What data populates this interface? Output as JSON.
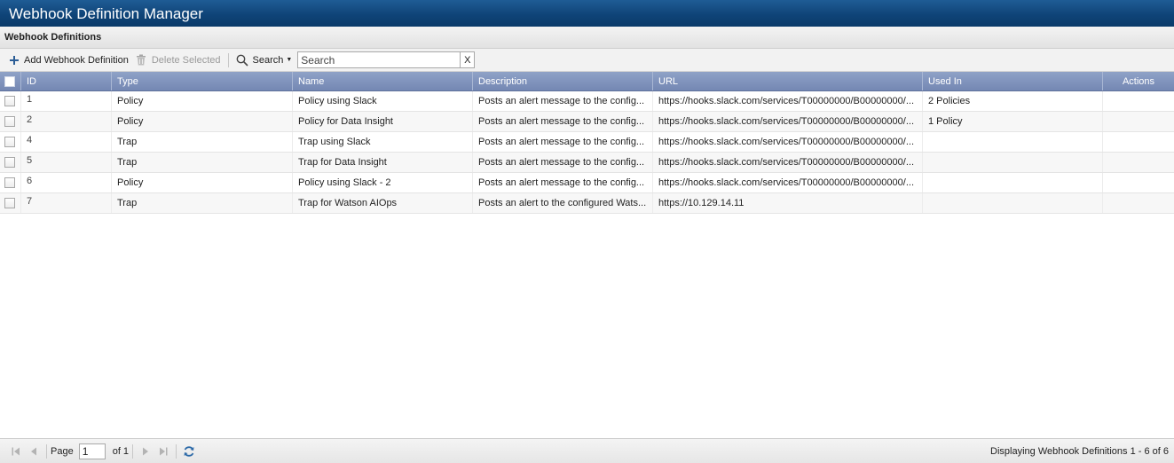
{
  "window": {
    "title": "Webhook Definition Manager"
  },
  "panel": {
    "title": "Webhook Definitions"
  },
  "toolbar": {
    "add_label": "Add Webhook Definition",
    "delete_label": "Delete Selected",
    "search_label": "Search",
    "search_placeholder": "Search",
    "clear_label": "X"
  },
  "grid": {
    "columns": {
      "id": "ID",
      "type": "Type",
      "name": "Name",
      "description": "Description",
      "url": "URL",
      "used_in": "Used In",
      "actions": "Actions"
    },
    "rows": [
      {
        "id": "1",
        "type": "Policy",
        "name": "Policy using Slack",
        "description": "Posts an alert message to the config...",
        "url": "https://hooks.slack.com/services/T00000000/B00000000/...",
        "used_in": "2 Policies"
      },
      {
        "id": "2",
        "type": "Policy",
        "name": "Policy for Data Insight",
        "description": "Posts an alert message to the config...",
        "url": "https://hooks.slack.com/services/T00000000/B00000000/...",
        "used_in": "1 Policy"
      },
      {
        "id": "4",
        "type": "Trap",
        "name": "Trap using Slack",
        "description": "Posts an alert message to the config...",
        "url": "https://hooks.slack.com/services/T00000000/B00000000/...",
        "used_in": ""
      },
      {
        "id": "5",
        "type": "Trap",
        "name": "Trap for Data Insight",
        "description": "Posts an alert message to the config...",
        "url": "https://hooks.slack.com/services/T00000000/B00000000/...",
        "used_in": ""
      },
      {
        "id": "6",
        "type": "Policy",
        "name": "Policy using Slack - 2",
        "description": "Posts an alert message to the config...",
        "url": "https://hooks.slack.com/services/T00000000/B00000000/...",
        "used_in": ""
      },
      {
        "id": "7",
        "type": "Trap",
        "name": "Trap for Watson AIOps",
        "description": "Posts an alert to the configured Wats...",
        "url": "https://10.129.14.11",
        "used_in": ""
      }
    ]
  },
  "footer": {
    "page_label": "Page",
    "page_value": "1",
    "of_label": "of 1",
    "display_message": "Displaying Webhook Definitions 1 - 6 of 6"
  },
  "colors": {
    "title_bar": "#0f4478",
    "grid_header": "#8094bd"
  },
  "icons": [
    "plus-icon",
    "trash-icon",
    "search-icon",
    "chevron-down-icon",
    "first-page-icon",
    "prev-page-icon",
    "next-page-icon",
    "last-page-icon",
    "refresh-icon"
  ]
}
